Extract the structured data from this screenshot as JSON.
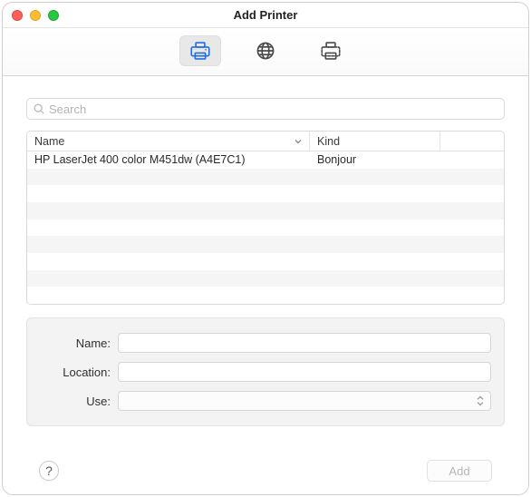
{
  "window_title": "Add Printer",
  "toolbar_tabs": [
    {
      "id": "default",
      "selected": true
    },
    {
      "id": "ip",
      "selected": false
    },
    {
      "id": "windows",
      "selected": false
    }
  ],
  "search": {
    "placeholder": "Search",
    "value": ""
  },
  "table": {
    "columns": {
      "name": "Name",
      "kind": "Kind"
    },
    "sort_column": "name",
    "rows": [
      {
        "name": "HP LaserJet 400 color M451dw (A4E7C1)",
        "kind": "Bonjour"
      }
    ]
  },
  "form": {
    "name_label": "Name:",
    "name_value": "",
    "location_label": "Location:",
    "location_value": "",
    "use_label": "Use:",
    "use_selected": ""
  },
  "footer": {
    "help_glyph": "?",
    "add_label": "Add",
    "add_enabled": false
  }
}
